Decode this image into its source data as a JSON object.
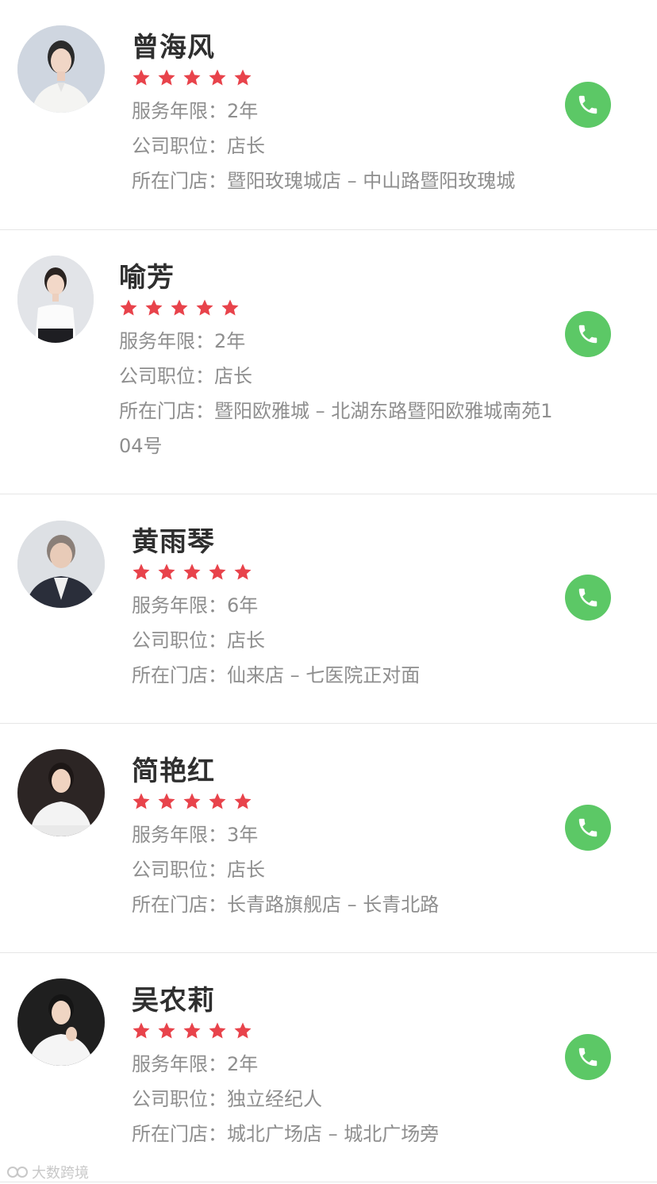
{
  "agents": [
    {
      "name": "曾海风",
      "rating": 5,
      "service_label": "服务年限：",
      "service_value": "2年",
      "position_label": "公司职位：",
      "position_value": "店长",
      "store_label": "所在门店：",
      "store_value": "暨阳玫瑰城店 – 中山路暨阳玫瑰城"
    },
    {
      "name": "喻芳",
      "rating": 5,
      "service_label": "服务年限：",
      "service_value": "2年",
      "position_label": "公司职位：",
      "position_value": "店长",
      "store_label": "所在门店：",
      "store_value": "暨阳欧雅城 – 北湖东路暨阳欧雅城南苑104号"
    },
    {
      "name": "黄雨琴",
      "rating": 5,
      "service_label": "服务年限：",
      "service_value": "6年",
      "position_label": "公司职位：",
      "position_value": "店长",
      "store_label": "所在门店：",
      "store_value": "仙来店 – 七医院正对面"
    },
    {
      "name": "简艳红",
      "rating": 5,
      "service_label": "服务年限：",
      "service_value": "3年",
      "position_label": "公司职位：",
      "position_value": "店长",
      "store_label": "所在门店：",
      "store_value": "长青路旗舰店 – 长青北路"
    },
    {
      "name": "吴农莉",
      "rating": 5,
      "service_label": "服务年限：",
      "service_value": "2年",
      "position_label": "公司职位：",
      "position_value": "独立经纪人",
      "store_label": "所在门店：",
      "store_value": "城北广场店 – 城北广场旁"
    }
  ],
  "icons": {
    "star": "star-icon",
    "call": "phone-icon"
  },
  "colors": {
    "star": "#e8434b",
    "call_button": "#5cc866",
    "muted_text": "#8e8e8e",
    "name_text": "#2f2f2f",
    "divider": "#e6e6e6"
  },
  "watermark": "大数跨境"
}
